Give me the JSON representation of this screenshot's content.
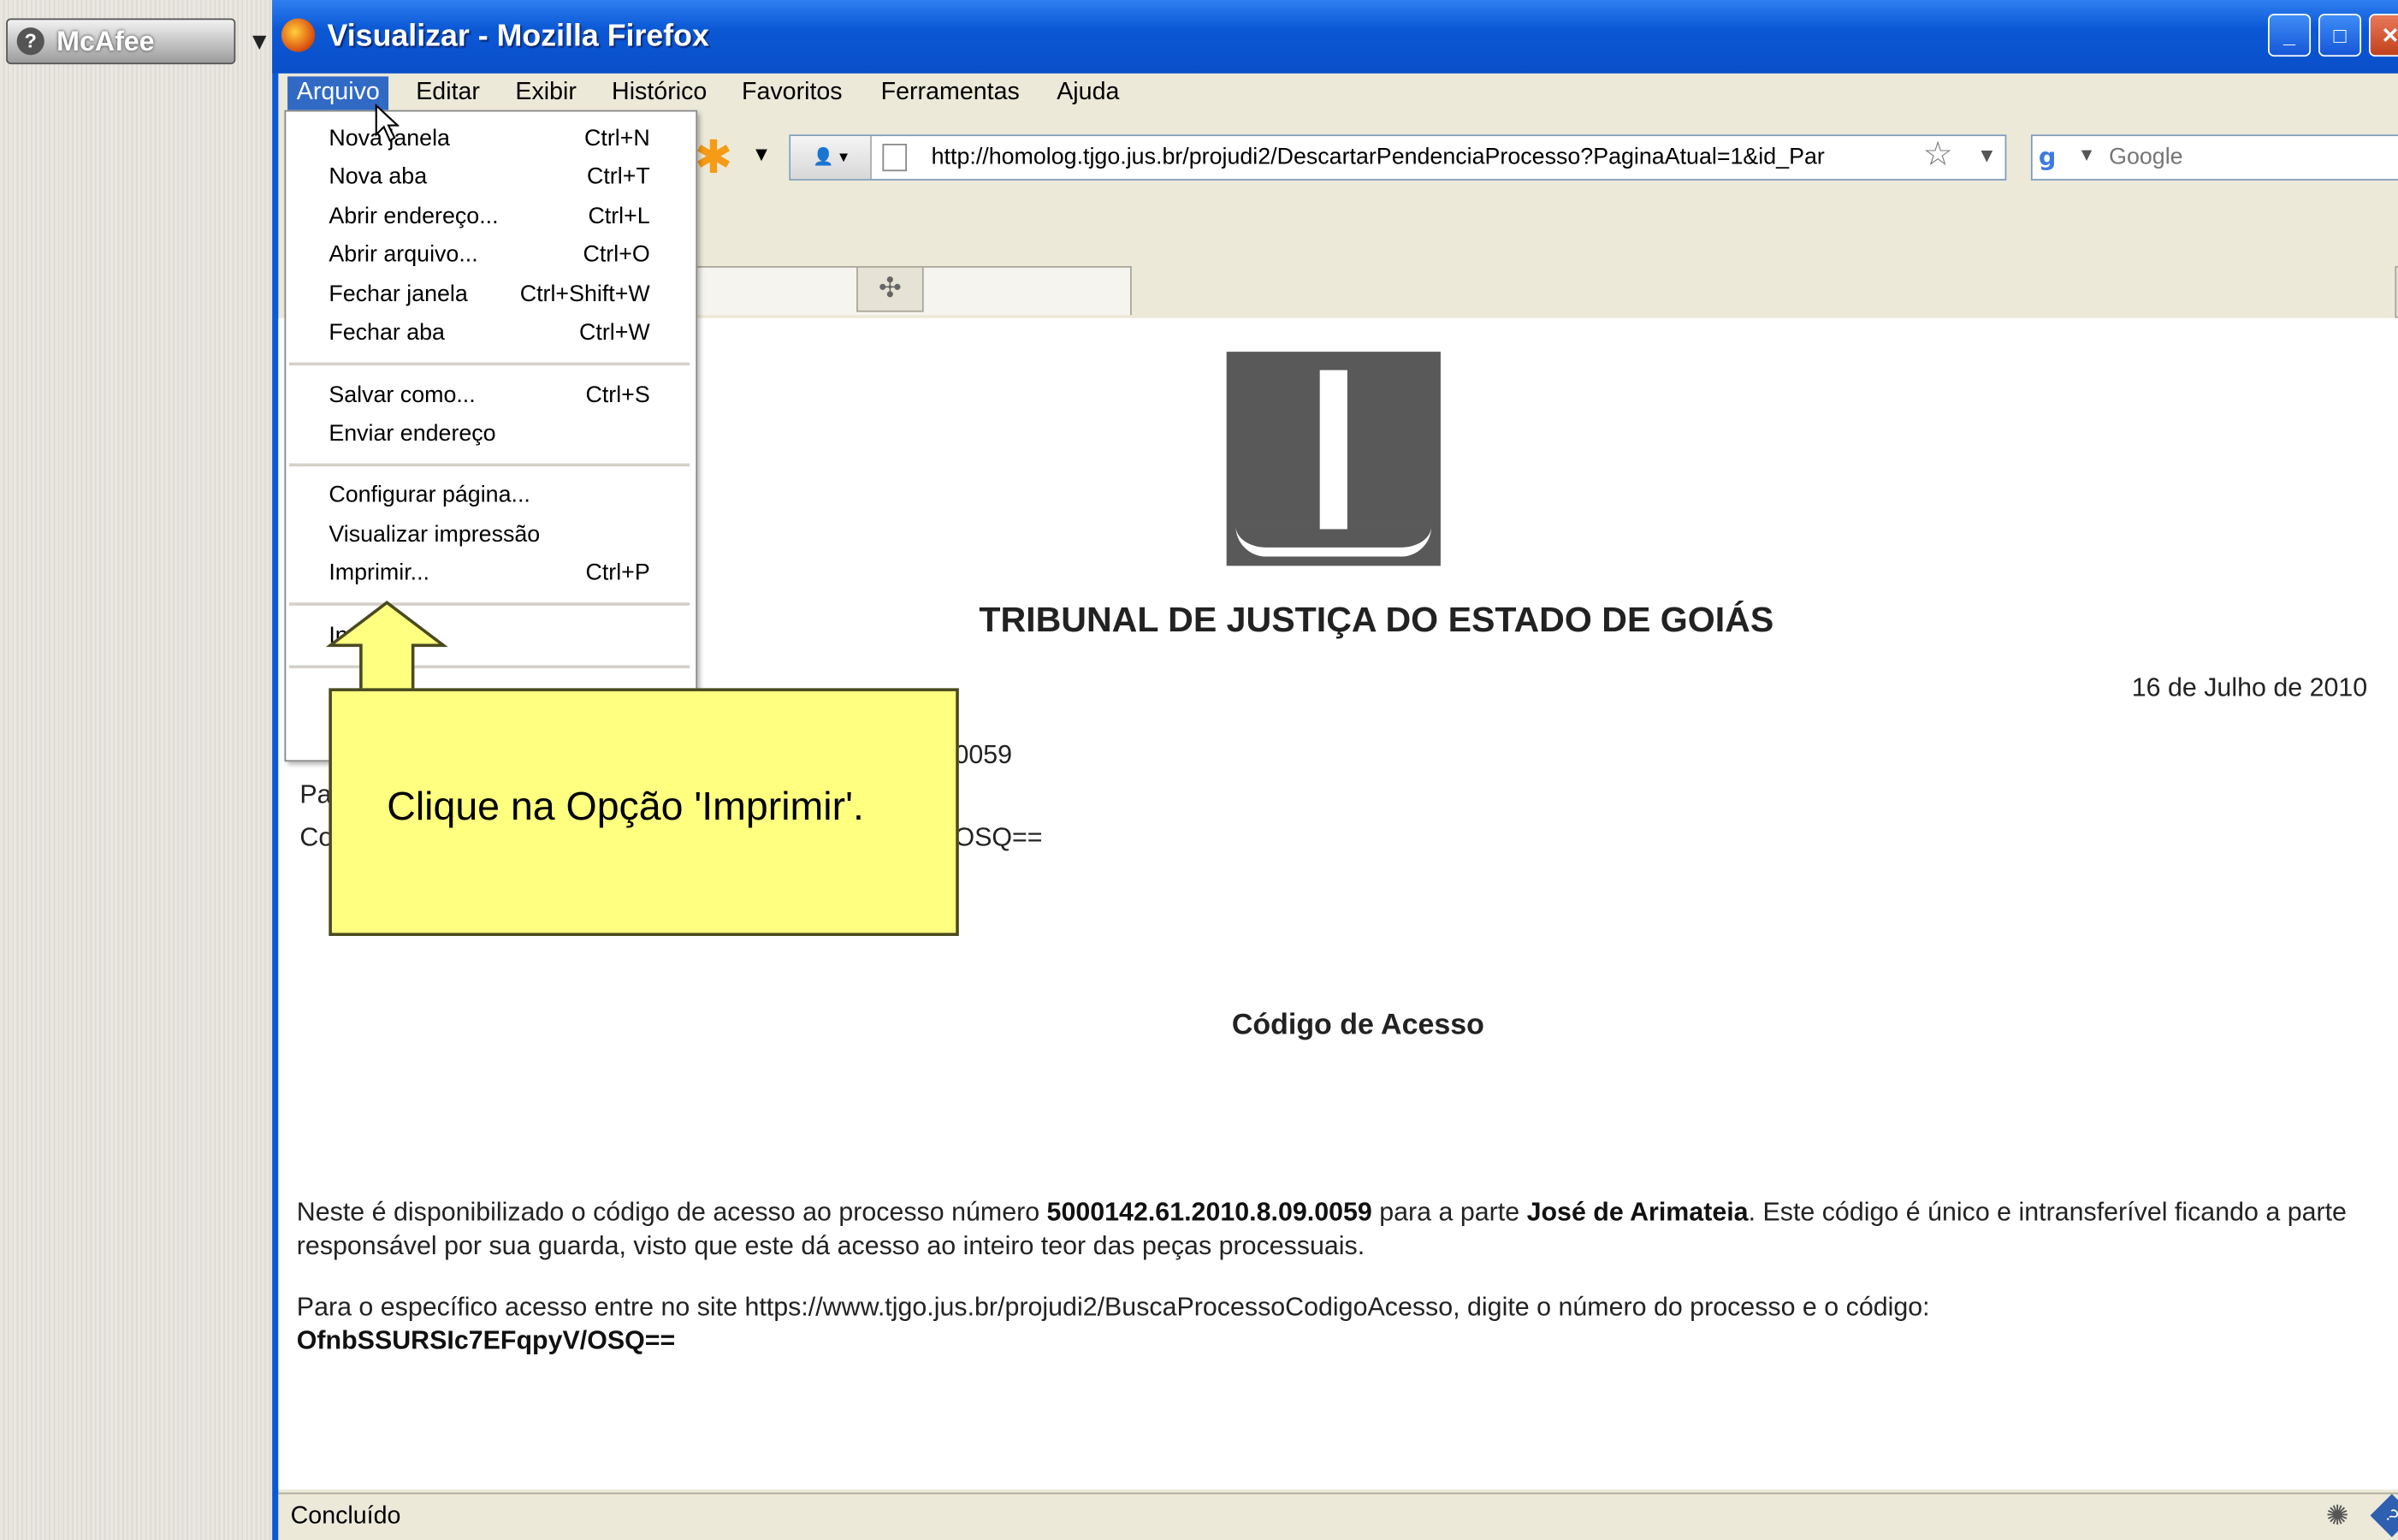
{
  "desktop": {
    "mcafee_label": "McAfee"
  },
  "window": {
    "title": "Visualizar - Mozilla Firefox"
  },
  "menubar": {
    "items": [
      {
        "label": "Arquivo"
      },
      {
        "label": "Editar"
      },
      {
        "label": "Exibir"
      },
      {
        "label": "Histórico"
      },
      {
        "label": "Favoritos"
      },
      {
        "label": "Ferramentas"
      },
      {
        "label": "Ajuda"
      }
    ]
  },
  "address_bar": {
    "url": "http://homolog.tjgo.jus.br/projudi2/DescartarPendenciaProcesso?PaginaAtual=1&id_Par"
  },
  "search": {
    "placeholder": "Google"
  },
  "file_menu": {
    "items": [
      {
        "label": "Nova janela",
        "shortcut": "Ctrl+N"
      },
      {
        "label": "Nova aba",
        "shortcut": "Ctrl+T"
      },
      {
        "label": "Abrir endereço...",
        "shortcut": "Ctrl+L"
      },
      {
        "label": "Abrir arquivo...",
        "shortcut": "Ctrl+O"
      },
      {
        "label": "Fechar janela",
        "shortcut": "Ctrl+Shift+W"
      },
      {
        "label": "Fechar aba",
        "shortcut": "Ctrl+W"
      },
      {
        "label": "Salvar como...",
        "shortcut": "Ctrl+S"
      },
      {
        "label": "Enviar endereço",
        "shortcut": ""
      },
      {
        "label": "Configurar página...",
        "shortcut": ""
      },
      {
        "label": "Visualizar impressão",
        "shortcut": ""
      },
      {
        "label": "Imprimir...",
        "shortcut": "Ctrl+P"
      },
      {
        "label": "In",
        "shortcut": ""
      }
    ]
  },
  "callout": {
    "text": "Clique na Opção 'Imprimir'."
  },
  "document": {
    "court_name": "TRIBUNAL DE JUSTIÇA DO ESTADO DE GOIÁS",
    "date": "16 de Julho de 2010",
    "partial_process_number": "0059",
    "partial_pa": "Pa",
    "partial_co": "Co",
    "partial_code": "OSQ==",
    "section_title": "Código de Acesso",
    "para1_a": "Neste é disponibilizado o código de acesso ao processo número ",
    "process_number": "5000142.61.2010.8.09.0059",
    "para1_b": " para a parte ",
    "party_name": "José de Arimateia",
    "para1_c": ". Este código é único e intransferível ficando a parte responsável por sua guarda, visto que este dá acesso ao inteiro teor das peças processuais.",
    "para2_a": "Para o específico acesso entre no site https://www.tjgo.jus.br/projudi2/BuscaProcessoCodigoAcesso, digite o número do processo e o código:",
    "access_code": "OfnbSSURSIc7EFqpyV/OSQ=="
  },
  "statusbar": {
    "text": "Concluído"
  },
  "colors": {
    "titlebar": "#0a5ad8",
    "menu_highlight": "#316ac5",
    "callout_bg": "#ffff80",
    "logo_bg": "#595959"
  }
}
